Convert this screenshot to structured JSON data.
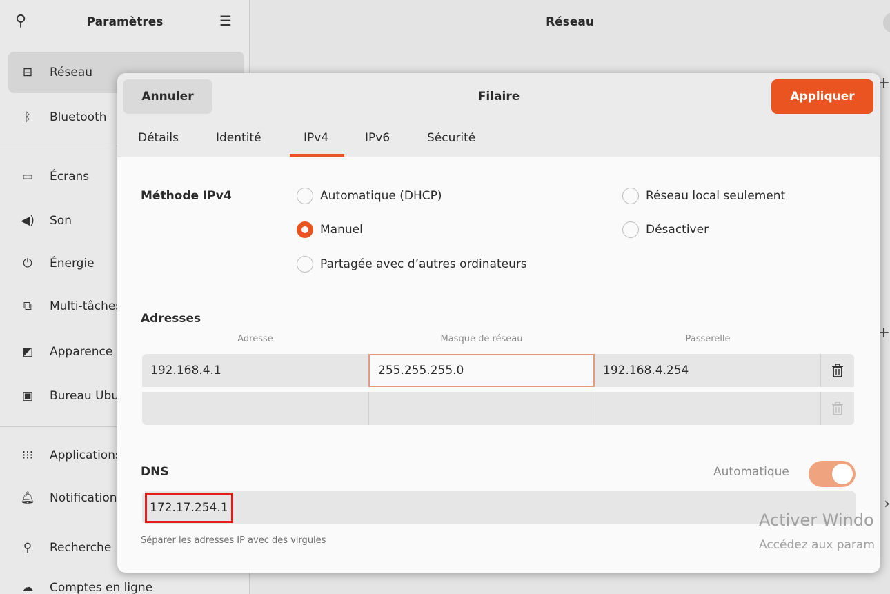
{
  "sidebar": {
    "title": "Paramètres",
    "items": [
      {
        "icon": "network-icon",
        "glyph": "⊟",
        "label": "Réseau"
      },
      {
        "icon": "bluetooth-icon",
        "glyph": "ᛒ",
        "label": "Bluetooth"
      },
      {
        "icon": "display-icon",
        "glyph": "▭",
        "label": "Écrans"
      },
      {
        "icon": "speaker-icon",
        "glyph": "◀)",
        "label": "Son"
      },
      {
        "icon": "power-icon",
        "glyph": "⏻",
        "label": "Énergie"
      },
      {
        "icon": "multitask-icon",
        "glyph": "⧉",
        "label": "Multi-tâches"
      },
      {
        "icon": "appearance-icon",
        "glyph": "◩",
        "label": "Apparence"
      },
      {
        "icon": "desktop-icon",
        "glyph": "▣",
        "label": "Bureau Ubuntu"
      },
      {
        "icon": "apps-icon",
        "glyph": "⁝⁝⁝",
        "label": "Applications"
      },
      {
        "icon": "bell-icon",
        "glyph": "🔔︎",
        "label": "Notifications"
      },
      {
        "icon": "search-icon",
        "glyph": "⚲",
        "label": "Recherche"
      },
      {
        "icon": "cloud-icon",
        "glyph": "☁",
        "label": "Comptes en ligne"
      }
    ]
  },
  "main": {
    "title": "Réseau"
  },
  "dialog": {
    "title": "Filaire",
    "cancel_label": "Annuler",
    "apply_label": "Appliquer",
    "tabs": [
      "Détails",
      "Identité",
      "IPv4",
      "IPv6",
      "Sécurité"
    ],
    "active_tab": "IPv4",
    "method": {
      "label": "Méthode IPv4",
      "options": [
        {
          "label": "Automatique (DHCP)",
          "checked": false
        },
        {
          "label": "Manuel",
          "checked": true
        },
        {
          "label": "Partagée avec d’autres ordinateurs",
          "checked": false
        },
        {
          "label": "Réseau local seulement",
          "checked": false
        },
        {
          "label": "Désactiver",
          "checked": false
        }
      ]
    },
    "addresses": {
      "label": "Adresses",
      "columns": [
        "Adresse",
        "Masque de réseau",
        "Passerelle"
      ],
      "rows": [
        {
          "address": "192.168.4.1",
          "netmask": "255.255.255.0",
          "gateway": "192.168.4.254"
        },
        {
          "address": "",
          "netmask": "",
          "gateway": ""
        }
      ]
    },
    "dns": {
      "label": "DNS",
      "auto_label": "Automatique",
      "auto_enabled": true,
      "value": "172.17.254.1",
      "hint": "Séparer les adresses IP avec des virgules"
    }
  },
  "watermark": {
    "line1": "Activer Windo",
    "line2": "Accédez aux param"
  },
  "colors": {
    "accent": "#e95420",
    "highlight_box": "#e21b1b"
  }
}
